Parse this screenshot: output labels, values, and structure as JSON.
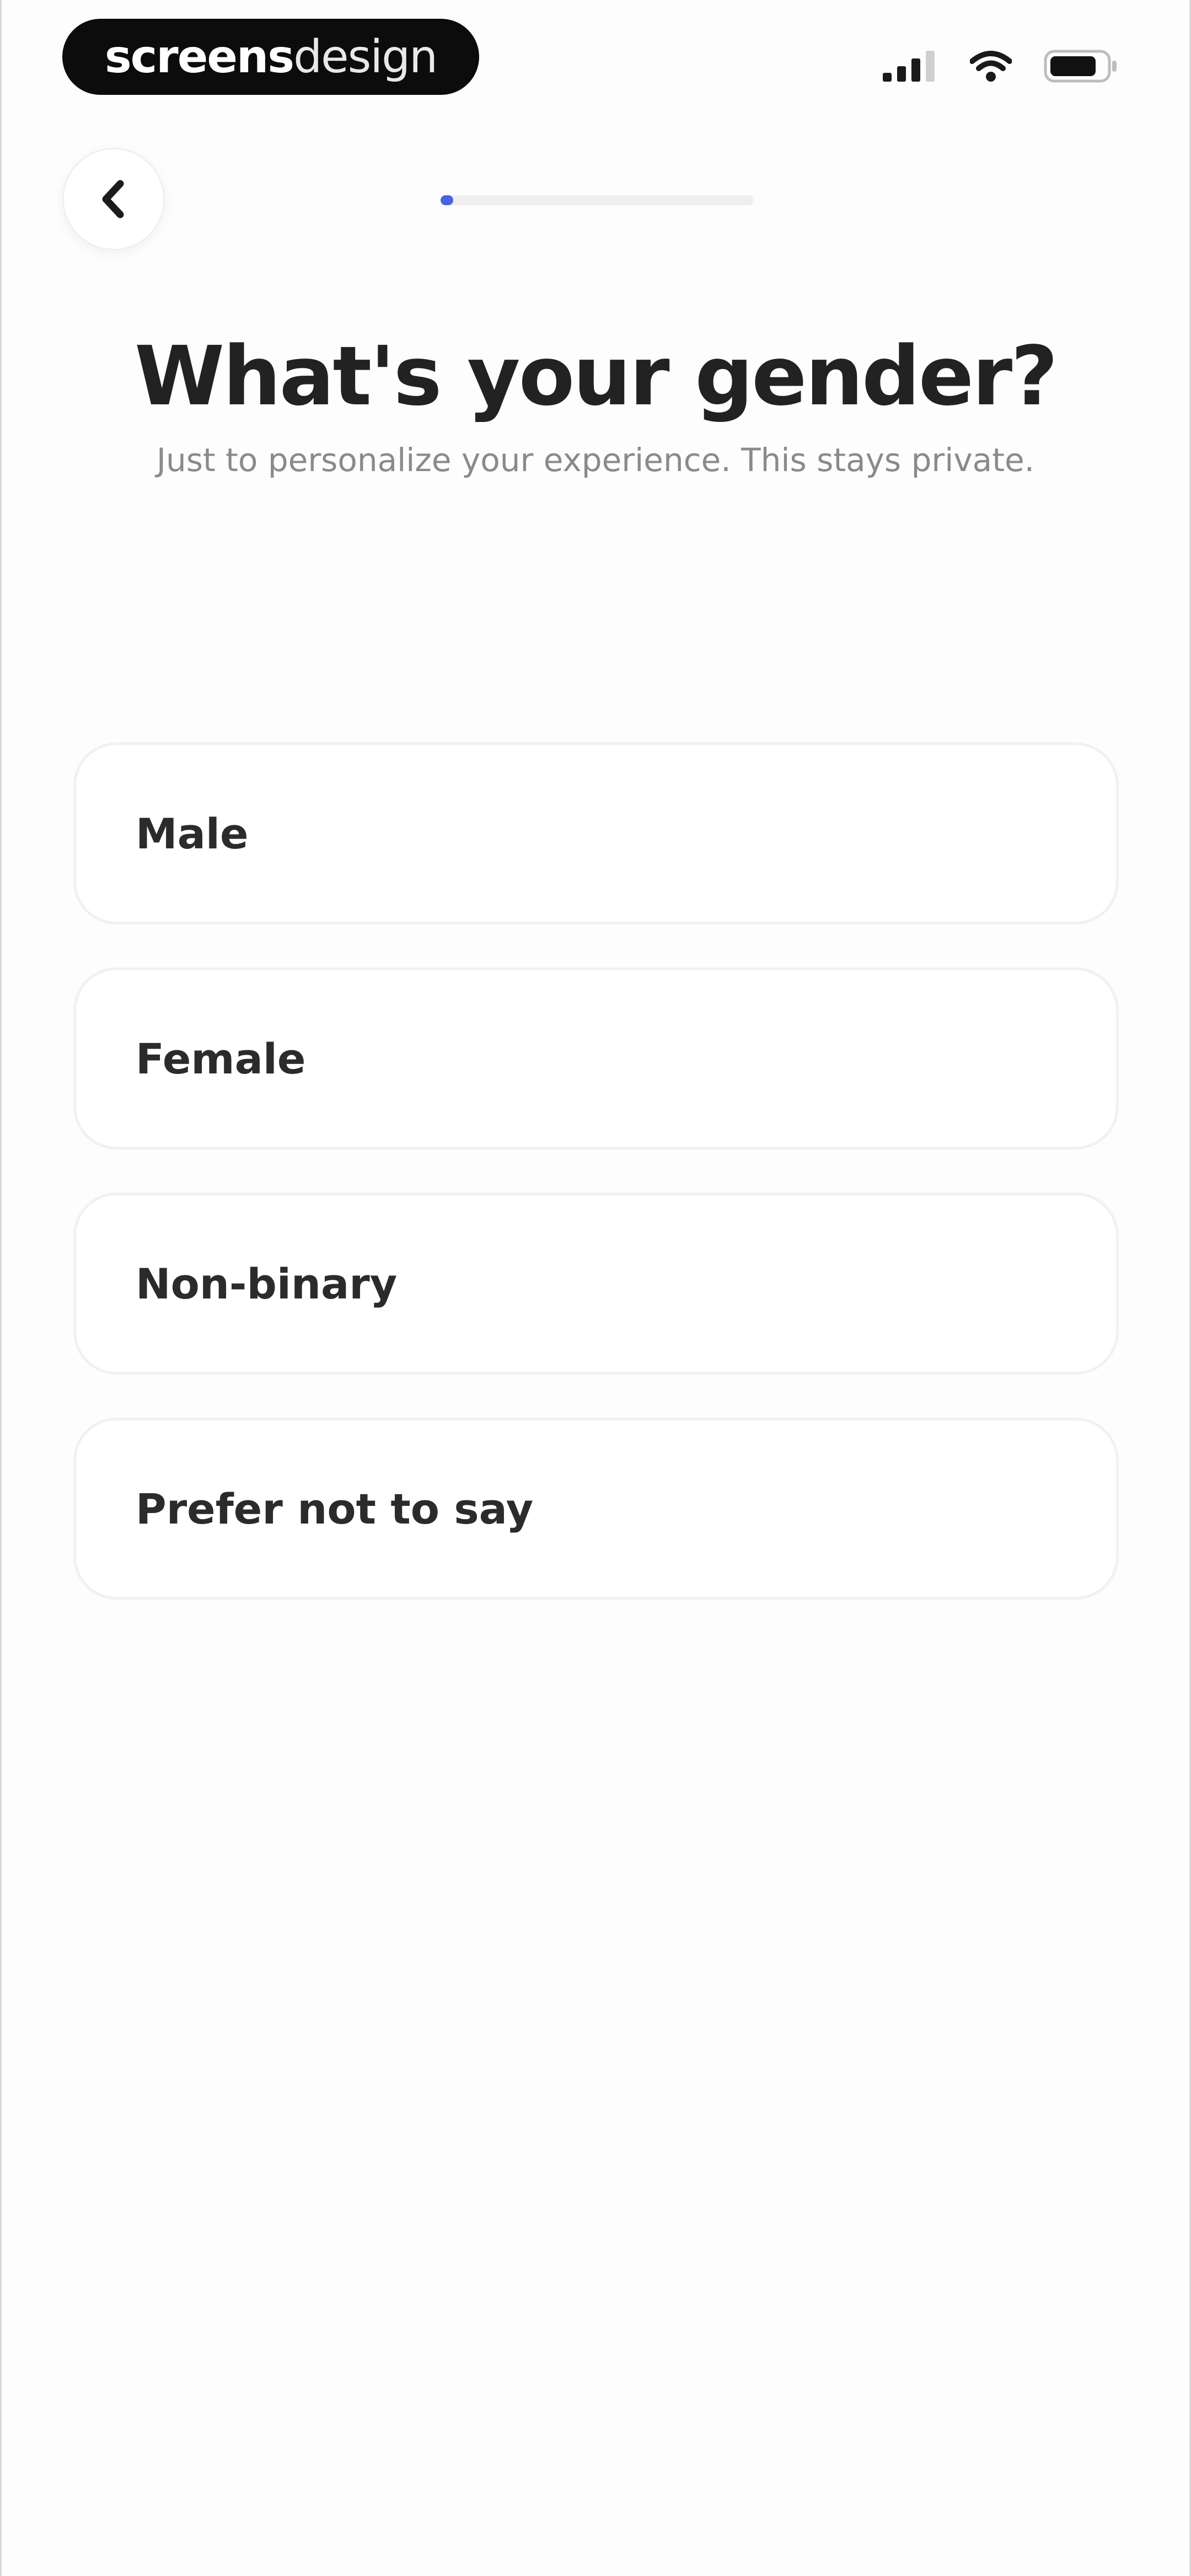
{
  "status_bar": {
    "brand_part1": "screens",
    "brand_part2": "design",
    "icons": [
      "cellular-signal-icon",
      "wifi-icon",
      "battery-icon"
    ]
  },
  "nav": {
    "back_icon": "chevron-left-icon",
    "progress_fraction": 0.04,
    "progress_color": "#4a63e0"
  },
  "header": {
    "title": "What's your gender?",
    "subtitle": "Just to personalize your experience. This stays private."
  },
  "options": [
    {
      "label": "Male"
    },
    {
      "label": "Female"
    },
    {
      "label": "Non-binary"
    },
    {
      "label": "Prefer not to say"
    }
  ]
}
